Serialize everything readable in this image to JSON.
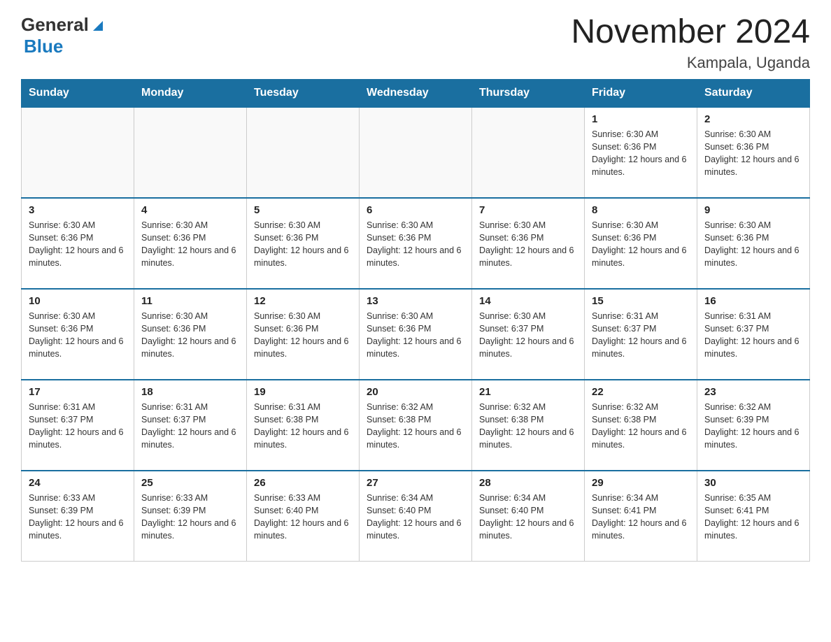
{
  "header": {
    "logo_general": "General",
    "logo_blue": "Blue",
    "title": "November 2024",
    "subtitle": "Kampala, Uganda"
  },
  "weekdays": [
    "Sunday",
    "Monday",
    "Tuesday",
    "Wednesday",
    "Thursday",
    "Friday",
    "Saturday"
  ],
  "weeks": [
    [
      {
        "day": "",
        "info": ""
      },
      {
        "day": "",
        "info": ""
      },
      {
        "day": "",
        "info": ""
      },
      {
        "day": "",
        "info": ""
      },
      {
        "day": "",
        "info": ""
      },
      {
        "day": "1",
        "info": "Sunrise: 6:30 AM\nSunset: 6:36 PM\nDaylight: 12 hours and 6 minutes."
      },
      {
        "day": "2",
        "info": "Sunrise: 6:30 AM\nSunset: 6:36 PM\nDaylight: 12 hours and 6 minutes."
      }
    ],
    [
      {
        "day": "3",
        "info": "Sunrise: 6:30 AM\nSunset: 6:36 PM\nDaylight: 12 hours and 6 minutes."
      },
      {
        "day": "4",
        "info": "Sunrise: 6:30 AM\nSunset: 6:36 PM\nDaylight: 12 hours and 6 minutes."
      },
      {
        "day": "5",
        "info": "Sunrise: 6:30 AM\nSunset: 6:36 PM\nDaylight: 12 hours and 6 minutes."
      },
      {
        "day": "6",
        "info": "Sunrise: 6:30 AM\nSunset: 6:36 PM\nDaylight: 12 hours and 6 minutes."
      },
      {
        "day": "7",
        "info": "Sunrise: 6:30 AM\nSunset: 6:36 PM\nDaylight: 12 hours and 6 minutes."
      },
      {
        "day": "8",
        "info": "Sunrise: 6:30 AM\nSunset: 6:36 PM\nDaylight: 12 hours and 6 minutes."
      },
      {
        "day": "9",
        "info": "Sunrise: 6:30 AM\nSunset: 6:36 PM\nDaylight: 12 hours and 6 minutes."
      }
    ],
    [
      {
        "day": "10",
        "info": "Sunrise: 6:30 AM\nSunset: 6:36 PM\nDaylight: 12 hours and 6 minutes."
      },
      {
        "day": "11",
        "info": "Sunrise: 6:30 AM\nSunset: 6:36 PM\nDaylight: 12 hours and 6 minutes."
      },
      {
        "day": "12",
        "info": "Sunrise: 6:30 AM\nSunset: 6:36 PM\nDaylight: 12 hours and 6 minutes."
      },
      {
        "day": "13",
        "info": "Sunrise: 6:30 AM\nSunset: 6:36 PM\nDaylight: 12 hours and 6 minutes."
      },
      {
        "day": "14",
        "info": "Sunrise: 6:30 AM\nSunset: 6:37 PM\nDaylight: 12 hours and 6 minutes."
      },
      {
        "day": "15",
        "info": "Sunrise: 6:31 AM\nSunset: 6:37 PM\nDaylight: 12 hours and 6 minutes."
      },
      {
        "day": "16",
        "info": "Sunrise: 6:31 AM\nSunset: 6:37 PM\nDaylight: 12 hours and 6 minutes."
      }
    ],
    [
      {
        "day": "17",
        "info": "Sunrise: 6:31 AM\nSunset: 6:37 PM\nDaylight: 12 hours and 6 minutes."
      },
      {
        "day": "18",
        "info": "Sunrise: 6:31 AM\nSunset: 6:37 PM\nDaylight: 12 hours and 6 minutes."
      },
      {
        "day": "19",
        "info": "Sunrise: 6:31 AM\nSunset: 6:38 PM\nDaylight: 12 hours and 6 minutes."
      },
      {
        "day": "20",
        "info": "Sunrise: 6:32 AM\nSunset: 6:38 PM\nDaylight: 12 hours and 6 minutes."
      },
      {
        "day": "21",
        "info": "Sunrise: 6:32 AM\nSunset: 6:38 PM\nDaylight: 12 hours and 6 minutes."
      },
      {
        "day": "22",
        "info": "Sunrise: 6:32 AM\nSunset: 6:38 PM\nDaylight: 12 hours and 6 minutes."
      },
      {
        "day": "23",
        "info": "Sunrise: 6:32 AM\nSunset: 6:39 PM\nDaylight: 12 hours and 6 minutes."
      }
    ],
    [
      {
        "day": "24",
        "info": "Sunrise: 6:33 AM\nSunset: 6:39 PM\nDaylight: 12 hours and 6 minutes."
      },
      {
        "day": "25",
        "info": "Sunrise: 6:33 AM\nSunset: 6:39 PM\nDaylight: 12 hours and 6 minutes."
      },
      {
        "day": "26",
        "info": "Sunrise: 6:33 AM\nSunset: 6:40 PM\nDaylight: 12 hours and 6 minutes."
      },
      {
        "day": "27",
        "info": "Sunrise: 6:34 AM\nSunset: 6:40 PM\nDaylight: 12 hours and 6 minutes."
      },
      {
        "day": "28",
        "info": "Sunrise: 6:34 AM\nSunset: 6:40 PM\nDaylight: 12 hours and 6 minutes."
      },
      {
        "day": "29",
        "info": "Sunrise: 6:34 AM\nSunset: 6:41 PM\nDaylight: 12 hours and 6 minutes."
      },
      {
        "day": "30",
        "info": "Sunrise: 6:35 AM\nSunset: 6:41 PM\nDaylight: 12 hours and 6 minutes."
      }
    ]
  ]
}
